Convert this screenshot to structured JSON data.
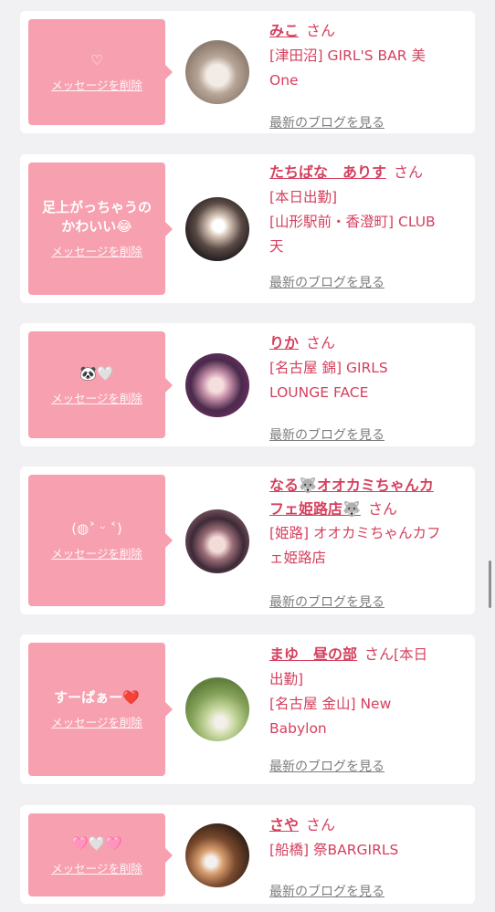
{
  "delete_label": "メッセージを削除",
  "blog_label": "最新のブログを見る",
  "san_label": "さん",
  "cards": [
    {
      "message": "♡",
      "name": "みこ",
      "shop_lines": [
        "[津田沼] GIRL'S BAR 美",
        "One"
      ]
    },
    {
      "message": "足上がっちゃうのかわいい😂",
      "name": "たちばな　ありす",
      "shop_lines": [
        "[本日出勤]",
        "[山形駅前・香澄町] CLUB",
        "天"
      ]
    },
    {
      "message": "🐼🤍",
      "name": "りか",
      "shop_lines": [
        "[名古屋 錦] GIRLS",
        "LOUNGE FACE"
      ]
    },
    {
      "message": "(◍˃ ᵕ ˂)",
      "name": "なる🐺オオカミちゃんカフェ姫路店🐺",
      "name_lines": [
        "なる🐺オオカミちゃんカ",
        "フェ姫路店🐺"
      ],
      "shop_lines": [
        "[姫路] オオカミちゃんカフ",
        "ェ姫路店"
      ]
    },
    {
      "message": "すーぱぁー❤️",
      "name": "まゆ　昼の部",
      "extra": "[本日",
      "shop_lines": [
        "出勤]",
        "[名古屋 金山] New",
        "Babylon"
      ]
    },
    {
      "message": "🩷🤍🩷",
      "name": "さや",
      "shop_lines": [
        "[船橋] 祭BARGIRLS"
      ]
    }
  ]
}
